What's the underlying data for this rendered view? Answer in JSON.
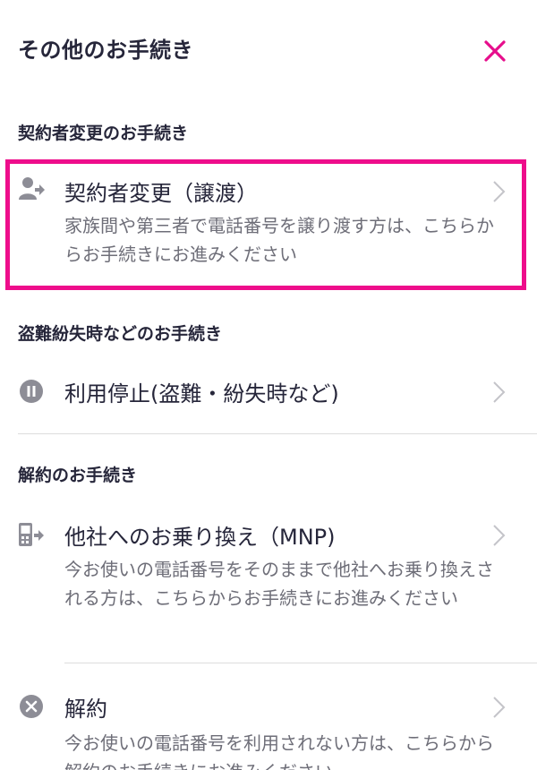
{
  "header": {
    "title": "その他のお手続き"
  },
  "colors": {
    "accent": "#e60e8c",
    "icon_gray": "#8d8d96",
    "divider": "#dddddd"
  },
  "sections": [
    {
      "heading": "契約者変更のお手続き",
      "items": [
        {
          "icon": "person-transfer-icon",
          "label": "契約者変更（譲渡）",
          "description": "家族間や第三者で電話番号を譲り渡す方は、こちらからお手続きにお進みください"
        }
      ]
    },
    {
      "heading": "盗難紛失時などのお手続き",
      "items": [
        {
          "icon": "pause-circle-icon",
          "label": "利用停止(盗難・紛失時など)"
        }
      ]
    },
    {
      "heading": "解約のお手続き",
      "items": [
        {
          "icon": "phone-transfer-icon",
          "label": "他社へのお乗り換え（MNP)",
          "description": "今お使いの電話番号をそのままで他社へお乗り換えされる方は、こちらからお手続きにお進みください"
        },
        {
          "icon": "x-circle-icon",
          "label": "解約",
          "description": "今お使いの電話番号を利用されない方は、こちらから解約のお手続きにお進みください"
        }
      ]
    }
  ]
}
